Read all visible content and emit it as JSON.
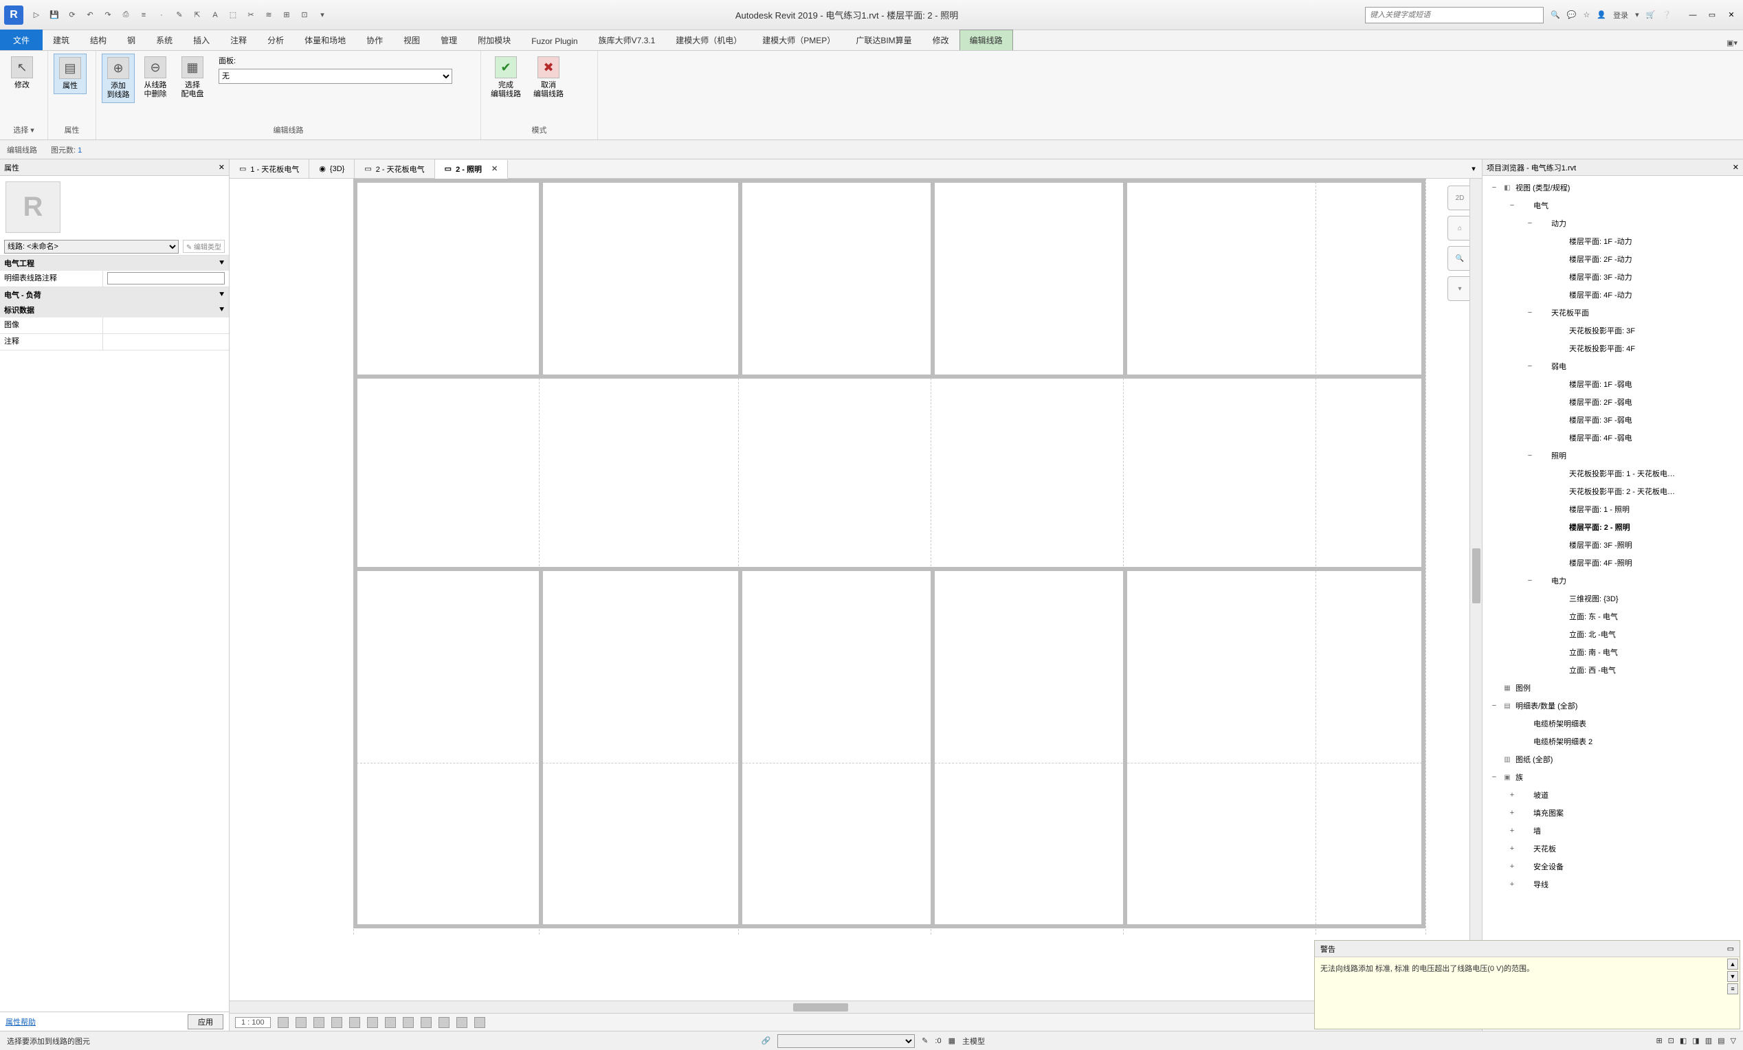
{
  "title": "Autodesk Revit 2019 - 电气练习1.rvt - 楼层平面: 2 - 照明",
  "search_placeholder": "键入关键字或短语",
  "login": "登录",
  "ribbon_tabs": [
    "文件",
    "建筑",
    "结构",
    "钢",
    "系统",
    "插入",
    "注释",
    "分析",
    "体量和场地",
    "协作",
    "视图",
    "管理",
    "附加模块",
    "Fuzor Plugin",
    "族库大师V7.3.1",
    "建模大师（机电）",
    "建模大师（PMEP）",
    "广联达BIM算量",
    "修改",
    "编辑线路"
  ],
  "ribbon_active_index": 19,
  "ribbon": {
    "select": {
      "btn": "修改",
      "label": "选择 ▾"
    },
    "props": {
      "btn": "属性",
      "label": "属性"
    },
    "circuit": {
      "add": "添加\n到线路",
      "remove": "从线路\n中删除",
      "panel": "选择\n配电盘",
      "paneltype_lbl": "面板:",
      "paneltype_val": "无",
      "label": "编辑线路"
    },
    "mode": {
      "finish": "完成\n编辑线路",
      "cancel": "取消\n编辑线路",
      "label": "模式"
    }
  },
  "subbar": {
    "a": "编辑线路",
    "b": "图元数:",
    "bcount": "1"
  },
  "props_panel": {
    "title": "属性",
    "type_sel": "线路: <未命名>",
    "edit_type": "✎ 编辑类型",
    "cat1": "电气工程",
    "row1_lbl": "明细表线路注释",
    "cat2": "电气 - 负荷",
    "cat3": "标识数据",
    "row2_lbl": "图像",
    "row3_lbl": "注释",
    "help": "属性帮助",
    "apply": "应用"
  },
  "view_tabs": [
    "1 - 天花板电气",
    "{3D}",
    "2 - 天花板电气",
    "2 - 照明"
  ],
  "view_tab_active": 3,
  "nav_items": [
    "2D",
    "⌂",
    "🔍",
    "▾"
  ],
  "view_scale": "1 : 100",
  "browser": {
    "title": "项目浏览器 - 电气练习1.rvt",
    "nodes": [
      {
        "t": "视图 (类型/规程)",
        "l": 0,
        "e": "−",
        "ic": "◧"
      },
      {
        "t": "电气",
        "l": 1,
        "e": "−"
      },
      {
        "t": "动力",
        "l": 2,
        "e": "−"
      },
      {
        "t": "楼层平面: 1F -动力",
        "l": 3
      },
      {
        "t": "楼层平面: 2F -动力",
        "l": 3
      },
      {
        "t": "楼层平面: 3F -动力",
        "l": 3
      },
      {
        "t": "楼层平面: 4F -动力",
        "l": 3
      },
      {
        "t": "天花板平面",
        "l": 2,
        "e": "−"
      },
      {
        "t": "天花板投影平面: 3F",
        "l": 3
      },
      {
        "t": "天花板投影平面: 4F",
        "l": 3
      },
      {
        "t": "弱电",
        "l": 2,
        "e": "−"
      },
      {
        "t": "楼层平面: 1F -弱电",
        "l": 3
      },
      {
        "t": "楼层平面: 2F -弱电",
        "l": 3
      },
      {
        "t": "楼层平面: 3F -弱电",
        "l": 3
      },
      {
        "t": "楼层平面: 4F -弱电",
        "l": 3
      },
      {
        "t": "照明",
        "l": 2,
        "e": "−"
      },
      {
        "t": "天花板投影平面: 1 - 天花板电…",
        "l": 3
      },
      {
        "t": "天花板投影平面: 2 - 天花板电…",
        "l": 3
      },
      {
        "t": "楼层平面: 1 - 照明",
        "l": 3
      },
      {
        "t": "楼层平面: 2 - 照明",
        "l": 3,
        "sel": true
      },
      {
        "t": "楼层平面: 3F -照明",
        "l": 3
      },
      {
        "t": "楼层平面: 4F -照明",
        "l": 3
      },
      {
        "t": "电力",
        "l": 2,
        "e": "−"
      },
      {
        "t": "三维视图: {3D}",
        "l": 3
      },
      {
        "t": "立面: 东 - 电气",
        "l": 3
      },
      {
        "t": "立面: 北 -电气",
        "l": 3
      },
      {
        "t": "立面: 南 - 电气",
        "l": 3
      },
      {
        "t": "立面: 西 -电气",
        "l": 3
      },
      {
        "t": "图例",
        "l": 0,
        "ic": "▦"
      },
      {
        "t": "明细表/数量 (全部)",
        "l": 0,
        "e": "−",
        "ic": "▤"
      },
      {
        "t": "电缆桥架明细表",
        "l": 1
      },
      {
        "t": "电缆桥架明细表 2",
        "l": 1
      },
      {
        "t": "图纸 (全部)",
        "l": 0,
        "ic": "▥"
      },
      {
        "t": "族",
        "l": 0,
        "e": "−",
        "ic": "▣"
      },
      {
        "t": "坡道",
        "l": 1,
        "e": "+"
      },
      {
        "t": "填充图案",
        "l": 1,
        "e": "+"
      },
      {
        "t": "墙",
        "l": 1,
        "e": "+"
      },
      {
        "t": "天花板",
        "l": 1,
        "e": "+"
      },
      {
        "t": "安全设备",
        "l": 1,
        "e": "+"
      },
      {
        "t": "导线",
        "l": 1,
        "e": "+"
      }
    ]
  },
  "warning": {
    "title": "警告",
    "msg": "无法向线路添加 标准, 标准 的电压超出了线路电压(0 V)的范围。"
  },
  "status": {
    "left": "选择要添加到线路的图元",
    "count": ":0",
    "model": "主模型"
  }
}
